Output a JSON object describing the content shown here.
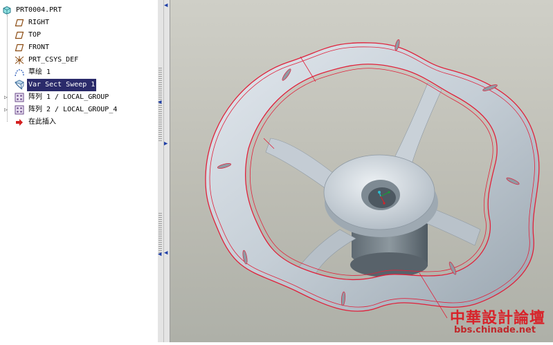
{
  "tree": {
    "root": {
      "label": "PRT0004.PRT",
      "icon": "part-icon"
    },
    "items": [
      {
        "label": "RIGHT",
        "icon": "datum-plane-icon"
      },
      {
        "label": "TOP",
        "icon": "datum-plane-icon"
      },
      {
        "label": "FRONT",
        "icon": "datum-plane-icon"
      },
      {
        "label": "PRT_CSYS_DEF",
        "icon": "coordinate-system-icon"
      },
      {
        "label": "草绘 1",
        "icon": "sketch-icon"
      },
      {
        "label": "Var Sect Sweep 1",
        "icon": "sweep-feature-icon",
        "selected": true
      },
      {
        "label": "阵列 1 / LOCAL_GROUP",
        "icon": "pattern-icon",
        "expandable": true
      },
      {
        "label": "阵列 2 / LOCAL_GROUP_4",
        "icon": "pattern-icon",
        "expandable": true
      },
      {
        "label": "在此插入",
        "icon": "insert-here-arrow-icon"
      }
    ]
  },
  "watermark": {
    "line1": "中華設計論壇",
    "line2": "bbs.chinade.net"
  },
  "colors": {
    "selection_bg": "#2a2a6a",
    "edge_highlight": "#e0203a",
    "model_surface": "#c7cfd6",
    "viewport_bg": "#c4c4bb",
    "watermark": "#d8232a"
  }
}
